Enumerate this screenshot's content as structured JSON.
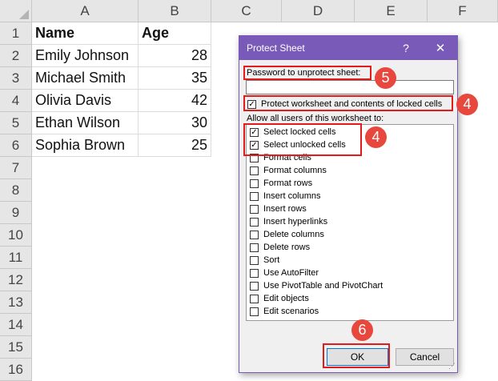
{
  "sheet": {
    "columns": [
      "A",
      "B",
      "C",
      "D",
      "E",
      "F"
    ],
    "rows": [
      "1",
      "2",
      "3",
      "4",
      "5",
      "6",
      "7",
      "8",
      "9",
      "10",
      "11",
      "12",
      "13",
      "14",
      "15",
      "16"
    ],
    "header": {
      "name": "Name",
      "age": "Age"
    },
    "records": [
      {
        "name": "Emily Johnson",
        "age": "28"
      },
      {
        "name": "Michael Smith",
        "age": "35"
      },
      {
        "name": "Olivia Davis",
        "age": "42"
      },
      {
        "name": "Ethan Wilson",
        "age": "30"
      },
      {
        "name": "Sophia Brown",
        "age": "25"
      }
    ]
  },
  "dialog": {
    "title": "Protect Sheet",
    "help_label": "?",
    "close_label": "✕",
    "password_label": "Password to unprotect sheet:",
    "password_value": "",
    "protect_label": "Protect worksheet and contents of locked cells",
    "protect_checked": true,
    "allow_label": "Allow all users of this worksheet to:",
    "permissions": [
      {
        "label": "Select locked cells",
        "checked": true
      },
      {
        "label": "Select unlocked cells",
        "checked": true
      },
      {
        "label": "Format cells",
        "checked": false
      },
      {
        "label": "Format columns",
        "checked": false
      },
      {
        "label": "Format rows",
        "checked": false
      },
      {
        "label": "Insert columns",
        "checked": false
      },
      {
        "label": "Insert rows",
        "checked": false
      },
      {
        "label": "Insert hyperlinks",
        "checked": false
      },
      {
        "label": "Delete columns",
        "checked": false
      },
      {
        "label": "Delete rows",
        "checked": false
      },
      {
        "label": "Sort",
        "checked": false
      },
      {
        "label": "Use AutoFilter",
        "checked": false
      },
      {
        "label": "Use PivotTable and PivotChart",
        "checked": false
      },
      {
        "label": "Edit objects",
        "checked": false
      },
      {
        "label": "Edit scenarios",
        "checked": false
      }
    ],
    "ok_label": "OK",
    "cancel_label": "Cancel"
  },
  "annotations": {
    "badge_password": "5",
    "badge_protect": "4",
    "badge_select": "4",
    "badge_ok": "6"
  },
  "colors": {
    "titlebar": "#7a5ab8",
    "highlight": "#e41b1b",
    "badge": "#e8473d"
  }
}
